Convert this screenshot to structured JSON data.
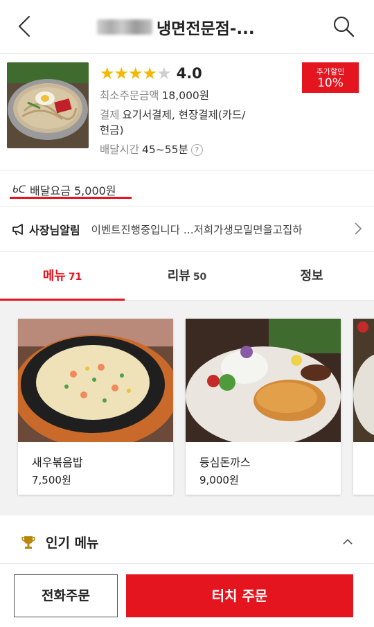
{
  "header": {
    "title": "냉면전문점-...",
    "back_icon": "chevron-left-icon",
    "search_icon": "search-icon"
  },
  "store": {
    "rating": {
      "stars_filled": 4,
      "stars_total": 5,
      "score": "4.0"
    },
    "min_order": {
      "label": "최소주문금액",
      "value": "18,000원"
    },
    "payment": {
      "label": "결제",
      "value_line1": "요기서결제, 현장결제(카드/",
      "value_line2": "현금)"
    },
    "delivery_time": {
      "label": "배달시간",
      "value": "45~55분",
      "help": "?"
    },
    "discount_badge": {
      "line1": "추가할인",
      "line2": "10%"
    }
  },
  "delivery_fee": {
    "icon": "bike-icon",
    "text": "배달요금 5,000원"
  },
  "notice": {
    "label": "사장님알림",
    "text": "이벤트진행중입니다 ...저희가생모밀면을고집하"
  },
  "tabs": [
    {
      "label": "메뉴",
      "count": "71",
      "active": true
    },
    {
      "label": "리뷰",
      "count": "50",
      "active": false
    },
    {
      "label": "정보",
      "count": "",
      "active": false
    }
  ],
  "menu_cards": [
    {
      "name": "새우볶음밥",
      "price": "7,500원"
    },
    {
      "name": "등심돈까스",
      "price": "9,000원"
    }
  ],
  "popular": {
    "title": "인기 메뉴",
    "icon": "trophy-icon"
  },
  "bottom": {
    "call_label": "전화주문",
    "order_label": "터치 주문"
  },
  "colors": {
    "accent": "#e4151f",
    "star": "#f5b800"
  }
}
